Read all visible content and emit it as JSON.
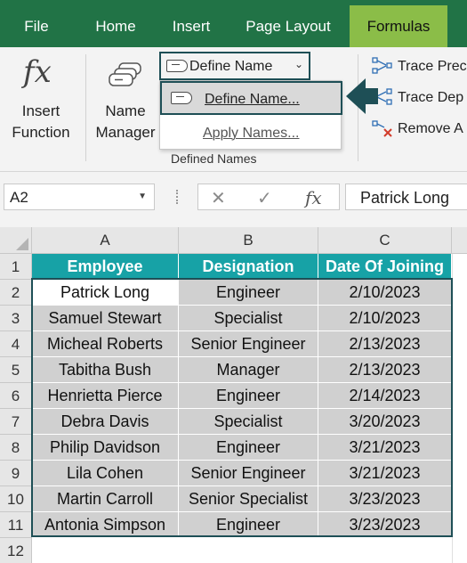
{
  "tabs": [
    "File",
    "Home",
    "Insert",
    "Page Layout",
    "Formulas"
  ],
  "active_tab": "Formulas",
  "ribbon": {
    "insert_function": [
      "Insert",
      "Function"
    ],
    "name_manager": [
      "Name",
      "Manager"
    ],
    "define_name_button": "Define Name",
    "dropdown": {
      "define_name": "Define Name...",
      "apply_names": "Apply Names..."
    },
    "group_label": "Defined Names",
    "trace_precedents": "Trace Prec",
    "trace_dependents": "Trace Dep",
    "remove_arrows": "Remove A"
  },
  "formula_bar": {
    "name_box": "A2",
    "content": "Patrick Long"
  },
  "grid": {
    "columns": [
      "A",
      "B",
      "C"
    ],
    "rows": [
      "1",
      "2",
      "3",
      "4",
      "5",
      "6",
      "7",
      "8",
      "9",
      "10",
      "11",
      "12"
    ],
    "header": [
      "Employee",
      "Designation",
      "Date Of Joining"
    ],
    "data": [
      [
        "Patrick Long",
        "Engineer",
        "2/10/2023"
      ],
      [
        "Samuel Stewart",
        "Specialist",
        "2/10/2023"
      ],
      [
        "Micheal Roberts",
        "Senior Engineer",
        "2/13/2023"
      ],
      [
        "Tabitha Bush",
        "Manager",
        "2/13/2023"
      ],
      [
        "Henrietta Pierce",
        "Engineer",
        "2/14/2023"
      ],
      [
        "Debra Davis",
        "Specialist",
        "3/20/2023"
      ],
      [
        "Philip Davidson",
        "Engineer",
        "3/21/2023"
      ],
      [
        "Lila Cohen",
        "Senior Engineer",
        "3/21/2023"
      ],
      [
        "Martin Carroll",
        "Senior Specialist",
        "3/23/2023"
      ],
      [
        "Antonia Simpson",
        "Engineer",
        "3/23/2023"
      ]
    ]
  },
  "colors": {
    "tab_bar": "#217346",
    "active_tab": "#8bbd48",
    "table_header": "#17a2a6",
    "table_body": "#d0d0d0",
    "highlight_border": "#1e4f56"
  },
  "icons": [
    "fx-icon",
    "name-manager-icon",
    "tag-icon",
    "chevron-down-icon",
    "arrow-left-icon",
    "trace-precedents-icon",
    "trace-dependents-icon",
    "remove-arrows-icon",
    "cancel-icon",
    "enter-icon"
  ]
}
